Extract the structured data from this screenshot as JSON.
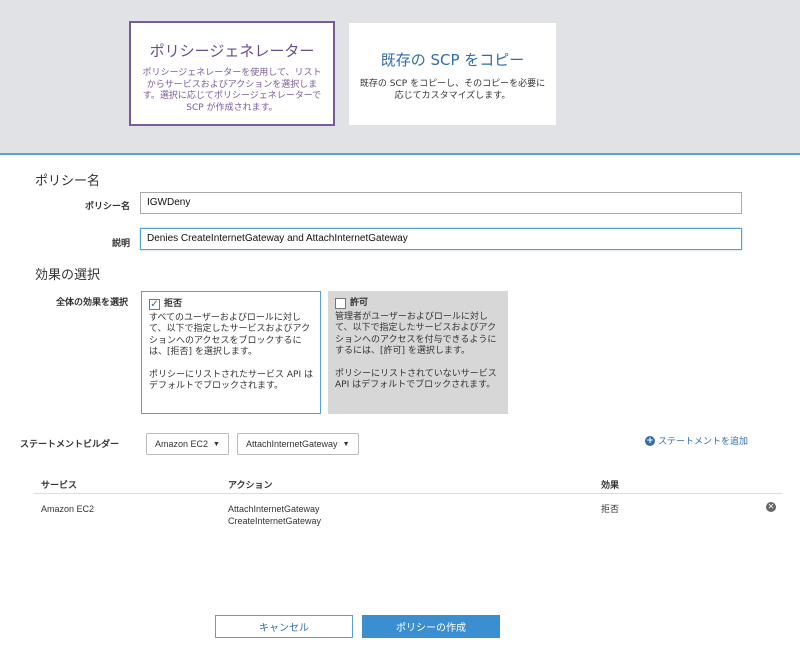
{
  "cards": {
    "generator": {
      "title": "ポリシージェネレーター",
      "desc": "ポリシージェネレーターを使用して、リストからサービスおよびアクションを選択します。選択に応じてポリシージェネレーターでSCP が作成されます。"
    },
    "copy": {
      "title": "既存の SCP をコピー",
      "desc": "既存の SCP をコピーし、そのコピーを必要に応じてカスタマイズします。"
    }
  },
  "policy": {
    "section_title": "ポリシー名",
    "name_label": "ポリシー名",
    "name_value": "IGWDeny",
    "desc_label": "説明",
    "desc_value": "Denies CreateInternetGateway and AttachInternetGateway"
  },
  "effect": {
    "section_title": "効果の選択",
    "label": "全体の効果を選択",
    "deny": {
      "title": "拒否",
      "checked": true,
      "desc": "すべてのユーザーおよびロールに対して、以下で指定したサービスおよびアクションへのアクセスをブロックするには、[拒否] を選択します。",
      "note": "ポリシーにリストされたサービス API はデフォルトでブロックされます。"
    },
    "allow": {
      "title": "許可",
      "checked": false,
      "desc": "管理者がユーザーおよびロールに対して、以下で指定したサービスおよびアクションへのアクセスを付与できるようにするには、[許可] を選択します。",
      "note": "ポリシーにリストされていないサービス API はデフォルトでブロックされます。"
    }
  },
  "builder": {
    "label": "ステートメントビルダー",
    "service_dropdown": "Amazon EC2",
    "action_dropdown": "AttachInternetGateway",
    "add_label": "ステートメントを追加"
  },
  "table": {
    "headers": [
      "サービス",
      "アクション",
      "効果"
    ],
    "rows": [
      {
        "service": "Amazon EC2",
        "actions": [
          "AttachInternetGateway",
          "CreateInternetGateway"
        ],
        "effect": "拒否"
      }
    ]
  },
  "buttons": {
    "cancel": "キャンセル",
    "create": "ポリシーの作成"
  },
  "icons": {
    "check": "check-icon",
    "caret": "chevron-down-icon",
    "add": "plus-circle-icon",
    "remove": "close-circle-icon"
  },
  "colors": {
    "accent": "#3b8fd1",
    "purple": "#7b5a99",
    "link": "#2f6dab"
  }
}
